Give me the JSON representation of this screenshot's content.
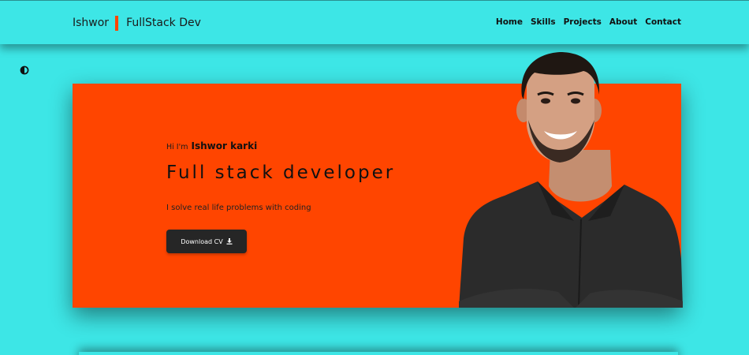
{
  "header": {
    "brand_first": "Ishwor",
    "brand_second": "FullStack Dev",
    "nav": [
      "Home",
      "Skills",
      "Projects",
      "About",
      "Contact"
    ]
  },
  "theme_toggle": {
    "icon": "half-circle-contrast-icon"
  },
  "hero": {
    "greeting_prefix": "Hi I'm",
    "name": "Ishwor karki",
    "title": "Full stack developer",
    "tagline": "I solve real life problems with coding",
    "cv_label": "Download CV",
    "cv_icon": "download-icon",
    "portrait": "portrait-photo"
  },
  "colors": {
    "background": "#3de6e6",
    "accent": "#ff4500",
    "button": "#262626"
  }
}
